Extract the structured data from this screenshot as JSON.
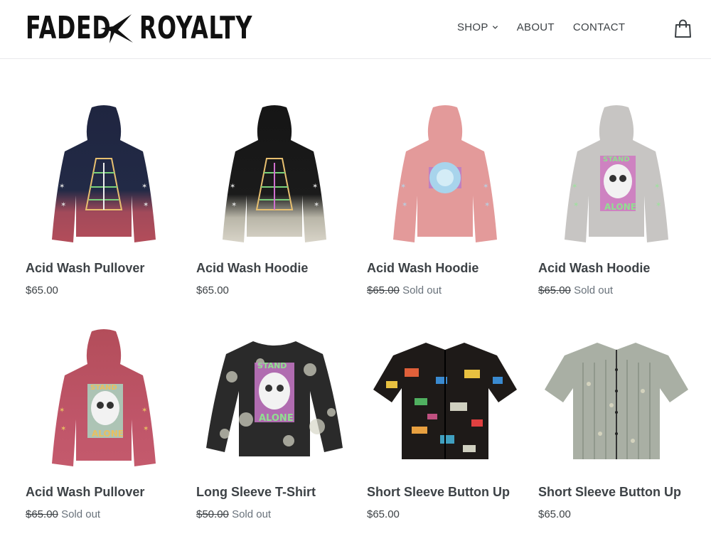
{
  "brand": {
    "word_left": "FADED",
    "word_right": "ROYALTY"
  },
  "nav": {
    "shop": "SHOP",
    "about": "ABOUT",
    "contact": "CONTACT"
  },
  "products": [
    {
      "title": "Acid Wash Pullover",
      "price": "$65.00",
      "sold_out": ""
    },
    {
      "title": "Acid Wash Hoodie",
      "price": "$65.00",
      "sold_out": ""
    },
    {
      "title": "Acid Wash Hoodie",
      "price": "$65.00",
      "sold_out": "Sold out"
    },
    {
      "title": "Acid Wash Hoodie",
      "price": "$65.00",
      "sold_out": "Sold out"
    },
    {
      "title": "Acid Wash Pullover",
      "price": "$65.00",
      "sold_out": "Sold out"
    },
    {
      "title": "Long Sleeve T-Shirt",
      "price": "$50.00",
      "sold_out": "Sold out"
    },
    {
      "title": "Short Sleeve Button Up",
      "price": "$65.00",
      "sold_out": ""
    },
    {
      "title": "Short Sleeve Button Up",
      "price": "$65.00",
      "sold_out": ""
    }
  ],
  "image_text": {
    "stand": "STAND",
    "alone": "ALONE"
  },
  "colors": {
    "text": "#3d4246",
    "sold_text": "#69727b",
    "navy": "#1f2540",
    "black": "#151515",
    "pink": "#e39a9a",
    "grey": "#c7c5c3",
    "red": "#b34d5a"
  }
}
